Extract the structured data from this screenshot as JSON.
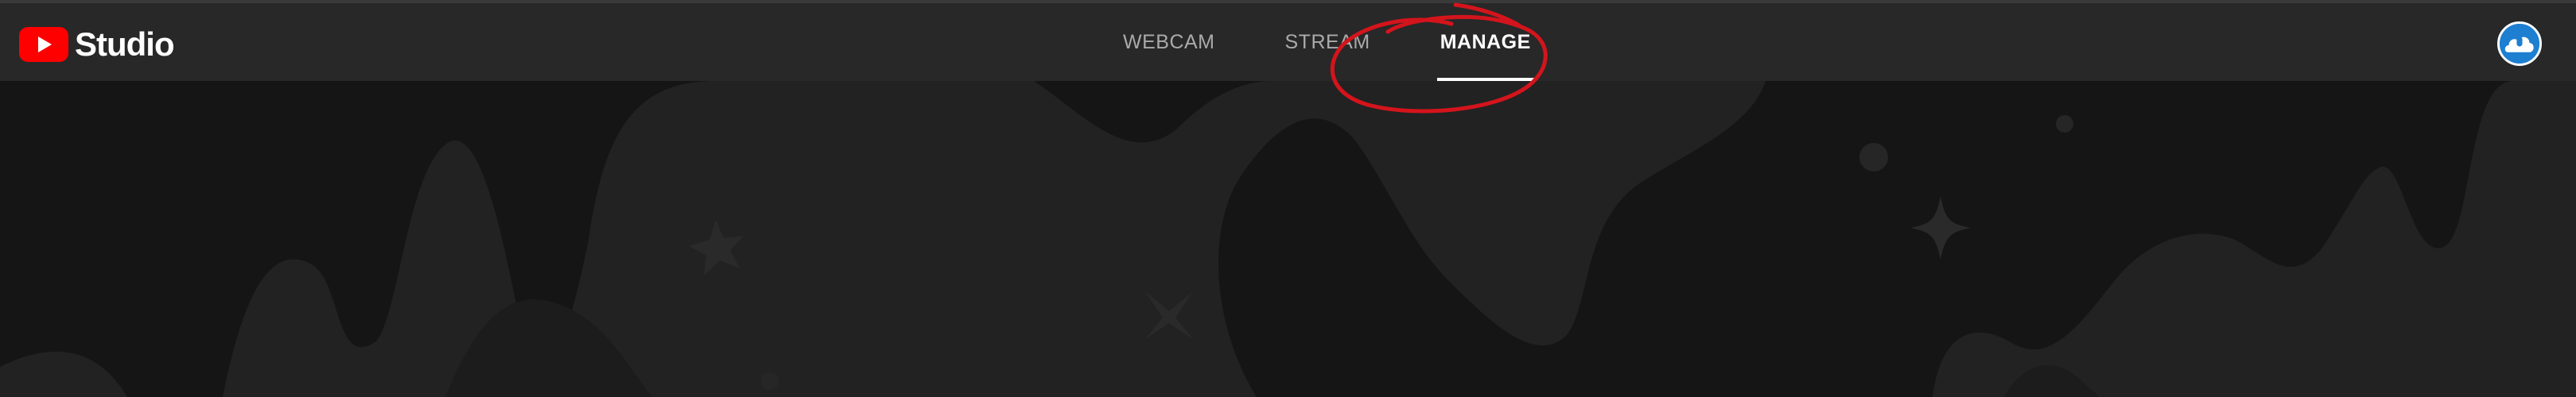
{
  "brand": {
    "name": "Studio",
    "logo_icon": "youtube-play-icon",
    "logo_color": "#ff0000"
  },
  "tabs": [
    {
      "label": "WEBCAM",
      "active": false
    },
    {
      "label": "STREAM",
      "active": false
    },
    {
      "label": "MANAGE",
      "active": true
    }
  ],
  "account": {
    "avatar_icon": "cloud-avatar-icon",
    "avatar_color": "#1e7fd0"
  },
  "annotation": {
    "type": "hand-drawn circle",
    "color": "#d4141c",
    "target": "MANAGE"
  },
  "colors": {
    "topbar": "#282828",
    "background": "#151515",
    "wave": "#222222",
    "active_tab": "#ffffff",
    "inactive_tab": "#aaaaaa"
  }
}
